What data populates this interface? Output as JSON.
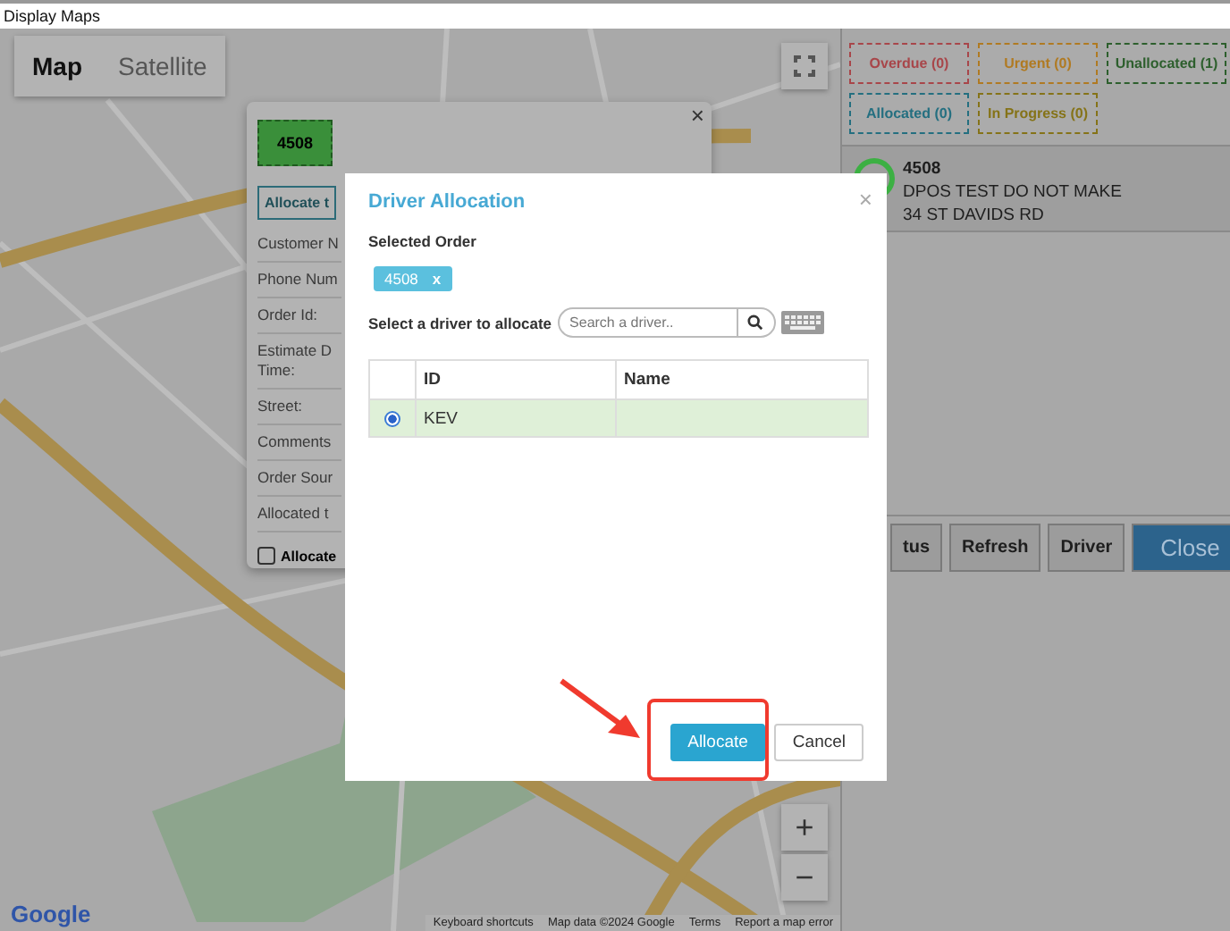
{
  "window": {
    "title": "Display Maps"
  },
  "map": {
    "type_buttons": [
      {
        "label": "Map",
        "selected": true
      },
      {
        "label": "Satellite",
        "selected": false
      }
    ],
    "zoom_in": "+",
    "zoom_out": "−",
    "logo": "Google",
    "footer_links": [
      "Keyboard shortcuts",
      "Map data ©2024 Google",
      "Terms",
      "Report a map error"
    ]
  },
  "info_popup": {
    "order_badge": "4508",
    "close": "×",
    "allocate_button": "Allocate t",
    "fields": [
      "Customer N",
      "Phone Num",
      "Order Id:",
      "Estimate D Time:",
      "Street:",
      "Comments",
      "Order Sour",
      "Allocated t"
    ],
    "checkbox": {
      "label": "Allocate",
      "checked": false
    }
  },
  "filters": [
    {
      "label": "Overdue (0)",
      "color": "#a8464a"
    },
    {
      "label": "Urgent (0)",
      "color": "#b07a22"
    },
    {
      "label": "Unallocated (1)",
      "color": "#2d5f2d"
    },
    {
      "label": "Allocated (0)",
      "color": "#246f80"
    },
    {
      "label": "In Progress (0)",
      "color": "#857318"
    }
  ],
  "orders": [
    {
      "number": "4508",
      "name": "DPOS TEST DO NOT MAKE",
      "address": "34 ST DAVIDS RD",
      "color": "#3cb043"
    }
  ],
  "actions": [
    {
      "label": "tus",
      "kind": "default"
    },
    {
      "label": "Refresh",
      "kind": "default"
    },
    {
      "label": "Driver",
      "kind": "default"
    },
    {
      "label": "Close",
      "kind": "primary"
    }
  ],
  "dialog": {
    "title": "Driver Allocation",
    "close": "×",
    "selected_order_label": "Selected Order",
    "chips": [
      {
        "label": "4508",
        "remove": "x"
      }
    ],
    "driver_label": "Select a driver to allocate",
    "search": {
      "placeholder": "Search a driver.."
    },
    "columns": [
      "ID",
      "Name"
    ],
    "rows": [
      {
        "id": "KEV",
        "selected": true
      }
    ],
    "buttons": [
      {
        "label": "Allocate",
        "kind": "primary"
      },
      {
        "label": "Cancel",
        "kind": "default"
      }
    ]
  }
}
